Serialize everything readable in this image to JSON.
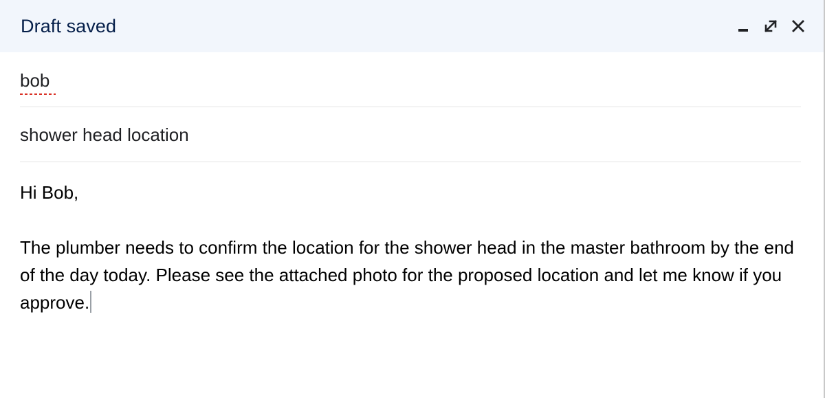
{
  "header": {
    "title": "Draft saved",
    "controls": [
      {
        "name": "minimize-icon"
      },
      {
        "name": "expand-icon"
      },
      {
        "name": "close-icon"
      }
    ]
  },
  "to": {
    "value": "bob"
  },
  "subject": {
    "value": "shower head location"
  },
  "body": {
    "greeting": "Hi Bob,",
    "paragraph": "The plumber needs to confirm the location for the shower head in the master bathroom by the end of the day today. Please see the attached photo for the proposed location and let me know if you approve."
  },
  "colors": {
    "header_bg": "#f2f6fc",
    "title": "#041e49",
    "spellcheck_underline": "#d93025",
    "divider": "#e3e3e3"
  }
}
